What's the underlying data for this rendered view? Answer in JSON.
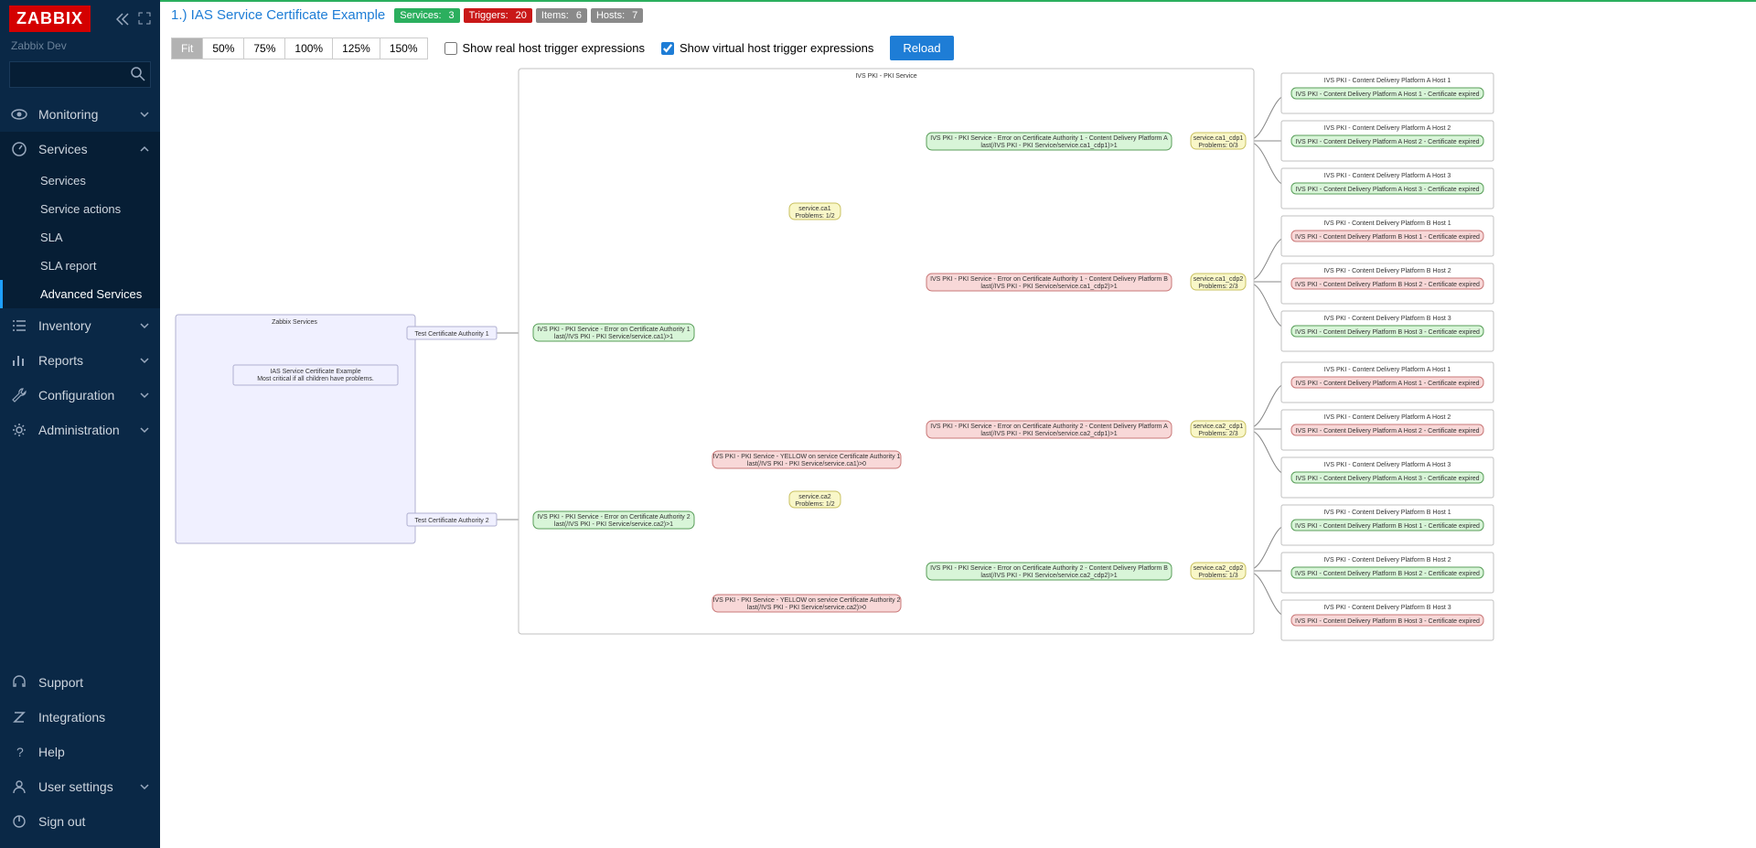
{
  "sidebar": {
    "logo": "ZABBIX",
    "tenant": "Zabbix Dev",
    "nav": {
      "monitoring": "Monitoring",
      "services": "Services",
      "inventory": "Inventory",
      "reports": "Reports",
      "configuration": "Configuration",
      "administration": "Administration"
    },
    "subnav": {
      "services": "Services",
      "service_actions": "Service actions",
      "sla": "SLA",
      "sla_report": "SLA report",
      "advanced_services": "Advanced Services"
    },
    "footer": {
      "support": "Support",
      "integrations": "Integrations",
      "help": "Help",
      "user_settings": "User settings",
      "sign_out": "Sign out"
    }
  },
  "header": {
    "title": "1.) IAS Service Certificate Example",
    "badges": {
      "services_label": "Services:",
      "services_val": "3",
      "triggers_label": "Triggers:",
      "triggers_val": "20",
      "items_label": "Items:",
      "items_val": "6",
      "hosts_label": "Hosts:",
      "hosts_val": "7"
    }
  },
  "toolbar": {
    "fit": "Fit",
    "z50": "50%",
    "z75": "75%",
    "z100": "100%",
    "z125": "125%",
    "z150": "150%",
    "show_real": "Show real host trigger expressions",
    "show_virtual": "Show virtual host trigger expressions",
    "reload": "Reload"
  },
  "graph": {
    "rootLabel": "Zabbix Services",
    "rootNode1": "IAS Service Certificate Example",
    "rootNode2": "Most critical if all children have problems.",
    "tca1": "Test Certificate Authority 1",
    "tca2": "Test Certificate Authority 2",
    "pkiService": "IVS PKI - PKI Service",
    "eca1_l1": "IVS PKI - PKI Service - Error on Certificate Authority 1",
    "eca1_l2": "last(/IVS PKI - PKI Service/service.ca1)>1",
    "eca2_l1": "IVS PKI - PKI Service - Error on Certificate Authority 2",
    "eca2_l2": "last(/IVS PKI - PKI Service/service.ca2)>1",
    "svcca1_l1": "service.ca1",
    "svcca1_l2": "Problems: 1/2",
    "svcca2_l1": "service.ca2",
    "svcca2_l2": "Problems: 1/2",
    "yca1_l1": "IVS PKI - PKI Service - YELLOW on service Certificate Authority 1",
    "yca1_l2": "last(/IVS PKI - PKI Service/service.ca1)>0",
    "yca2_l1": "IVS PKI - PKI Service - YELLOW on service Certificate Authority 2",
    "yca2_l2": "last(/IVS PKI - PKI Service/service.ca2)>0",
    "eca1cdpA_l1": "IVS PKI - PKI Service - Error on Certificate Authority 1 - Content Delivery Platform A",
    "eca1cdpA_l2": "last(/IVS PKI - PKI Service/service.ca1_cdp1)>1",
    "eca1cdpB_l1": "IVS PKI - PKI Service - Error on Certificate Authority 1 - Content Delivery Platform B",
    "eca1cdpB_l2": "last(/IVS PKI - PKI Service/service.ca1_cdp2)>1",
    "eca2cdpA_l1": "IVS PKI - PKI Service - Error on Certificate Authority 2 - Content Delivery Platform A",
    "eca2cdpA_l2": "last(/IVS PKI - PKI Service/service.ca2_cdp1)>1",
    "eca2cdpB_l1": "IVS PKI - PKI Service - Error on Certificate Authority 2 - Content Delivery Platform B",
    "eca2cdpB_l2": "last(/IVS PKI - PKI Service/service.ca2_cdp2)>1",
    "svc_ca1_cdp1_l1": "service.ca1_cdp1",
    "svc_ca1_cdp1_l2": "Problems: 0/3",
    "svc_ca1_cdp2_l1": "service.ca1_cdp2",
    "svc_ca1_cdp2_l2": "Problems: 2/3",
    "svc_ca2_cdp1_l1": "service.ca2_cdp1",
    "svc_ca2_cdp1_l2": "Problems: 2/3",
    "svc_ca2_cdp2_l1": "service.ca2_cdp2",
    "svc_ca2_cdp2_l2": "Problems: 1/3",
    "hA1": "IVS PKI - Content Delivery Platform A Host 1",
    "hA2": "IVS PKI - Content Delivery Platform A Host 2",
    "hA3": "IVS PKI - Content Delivery Platform A Host 3",
    "hB1": "IVS PKI - Content Delivery Platform B Host 1",
    "hB2": "IVS PKI - Content Delivery Platform B Host 2",
    "hB3": "IVS PKI - Content Delivery Platform B Host 3",
    "hA1t": "IVS PKI - Content Delivery Platform A Host 1 - Certificate expired",
    "hA2t": "IVS PKI - Content Delivery Platform A Host 2 - Certificate expired",
    "hA3t": "IVS PKI - Content Delivery Platform A Host 3 - Certificate expired",
    "hB1t": "IVS PKI - Content Delivery Platform B Host 1 - Certificate expired",
    "hB2t": "IVS PKI - Content Delivery Platform B Host 2 - Certificate expired",
    "hB3t": "IVS PKI - Content Delivery Platform B Host 3 - Certificate expired"
  }
}
